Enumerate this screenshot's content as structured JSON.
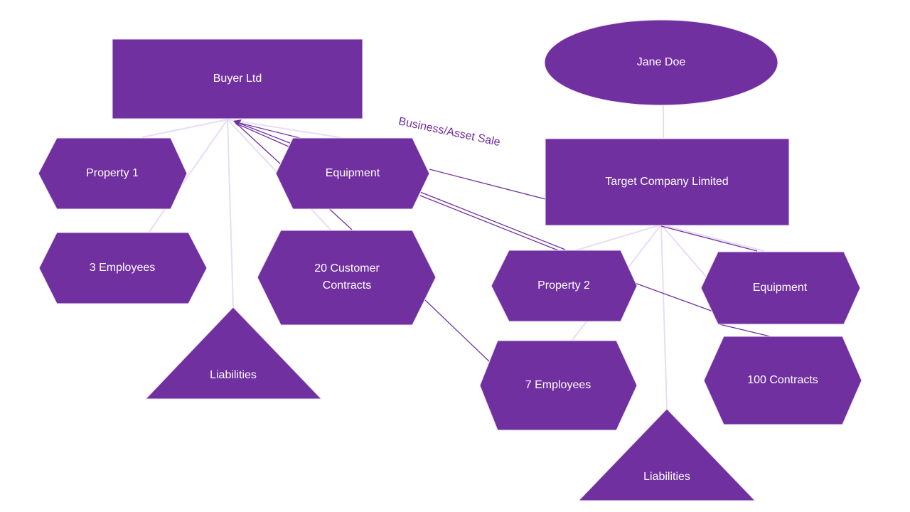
{
  "colors": {
    "shape_fill": "#7030A0",
    "connector_light": "#E8DCF6",
    "connector_dark": "#7030A0"
  },
  "buyer": {
    "title": "Buyer Ltd",
    "assets": {
      "property": "Property 1",
      "employees": "3 Employees",
      "equipment": "Equipment",
      "contracts_line1": "20 Customer",
      "contracts_line2": "Contracts",
      "liabilities": "Liabilities"
    }
  },
  "transaction_label": "Business/Asset Sale",
  "owner": {
    "name": "Jane Doe"
  },
  "target": {
    "title": "Target Company Limited",
    "assets": {
      "property": "Property 2",
      "equipment": "Equipment",
      "employees": "7 Employees",
      "contracts": "100 Contracts",
      "liabilities": "Liabilities"
    }
  }
}
